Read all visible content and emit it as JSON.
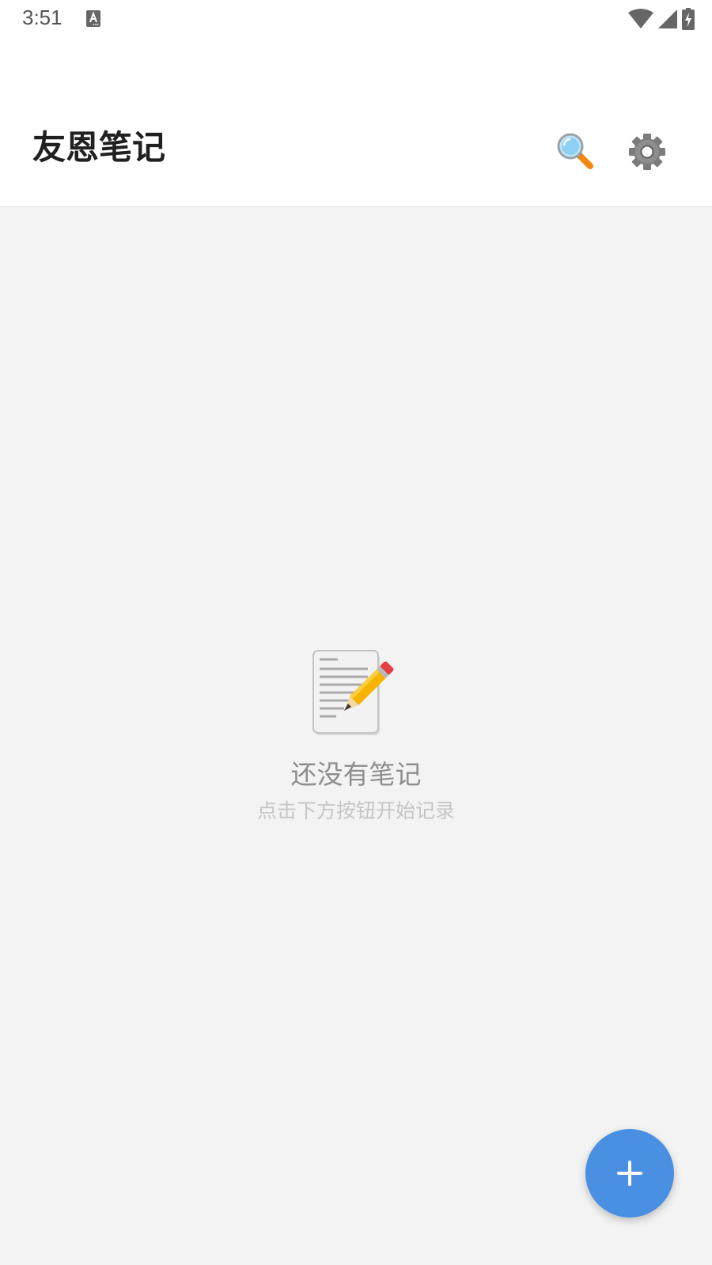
{
  "status_bar": {
    "time": "3:51",
    "icons": [
      "text-notification-icon",
      "wifi-icon",
      "cellular-signal-icon",
      "battery-charging-icon"
    ]
  },
  "app_bar": {
    "title": "友恩笔记",
    "actions": [
      {
        "name": "search",
        "icon": "magnifying-glass-icon"
      },
      {
        "name": "settings",
        "icon": "gear-icon"
      }
    ]
  },
  "empty_state": {
    "icon": "memo-pencil-icon",
    "title": "还没有笔记",
    "subtitle": "点击下方按钮开始记录"
  },
  "fab": {
    "icon": "plus-icon",
    "color": "#4a90e2"
  },
  "colors": {
    "background": "#f3f3f3",
    "app_bar": "#ffffff",
    "title_text": "#202020",
    "empty_title": "#8e8e8e",
    "empty_subtitle": "#c6c6c6",
    "accent": "#4a90e2"
  }
}
